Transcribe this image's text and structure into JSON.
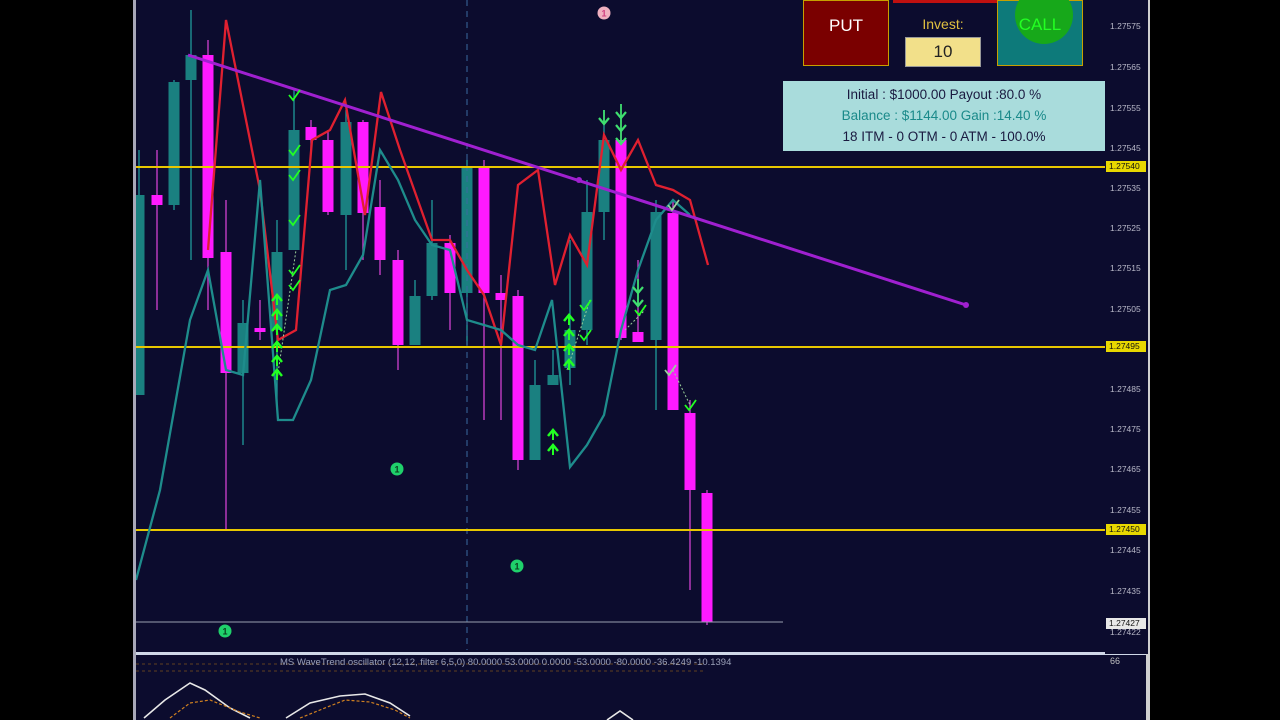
{
  "toolbar": {
    "put_label": "PUT",
    "call_label": "CALL",
    "invest_label": "Invest:",
    "invest_value": "10"
  },
  "info_panel": {
    "line1": "Initial : $1000.00 Payout :80.0 %",
    "line2": "Balance : $1144.00 Gain :14.40 %",
    "line3": "18 ITM - 0 OTM - 0 ATM - 100.0%"
  },
  "price_axis": {
    "ticks": [
      "1.27575",
      "1.27565",
      "1.27555",
      "1.27545",
      "1.27535",
      "1.27525",
      "1.27515",
      "1.27505",
      "1.27485",
      "1.27475",
      "1.27465",
      "1.27455",
      "1.27445",
      "1.27435",
      "1.27422"
    ],
    "tags": [
      "1.27540",
      "1.27495",
      "1.27450"
    ],
    "current_price": "1.27427"
  },
  "oscillator": {
    "label": "MS WaveTrend oscillator (12,12, filter 6,5,0) 80.0000 53.0000 0.0000 -53.0000 -80.0000 -36.4249 -10.1394",
    "axis_value": "66"
  },
  "colors": {
    "background": "#0c0c2e",
    "bull_candle": "#1a8080",
    "bear_candle": "#ff1aff",
    "level_line": "#e8c800",
    "trend_line": "#a020d0",
    "red_line": "#e02030",
    "teal_line": "#1e8c8c",
    "arrow_green": "#22ff22"
  },
  "markers": [
    "1",
    "1",
    "1",
    "1"
  ]
}
